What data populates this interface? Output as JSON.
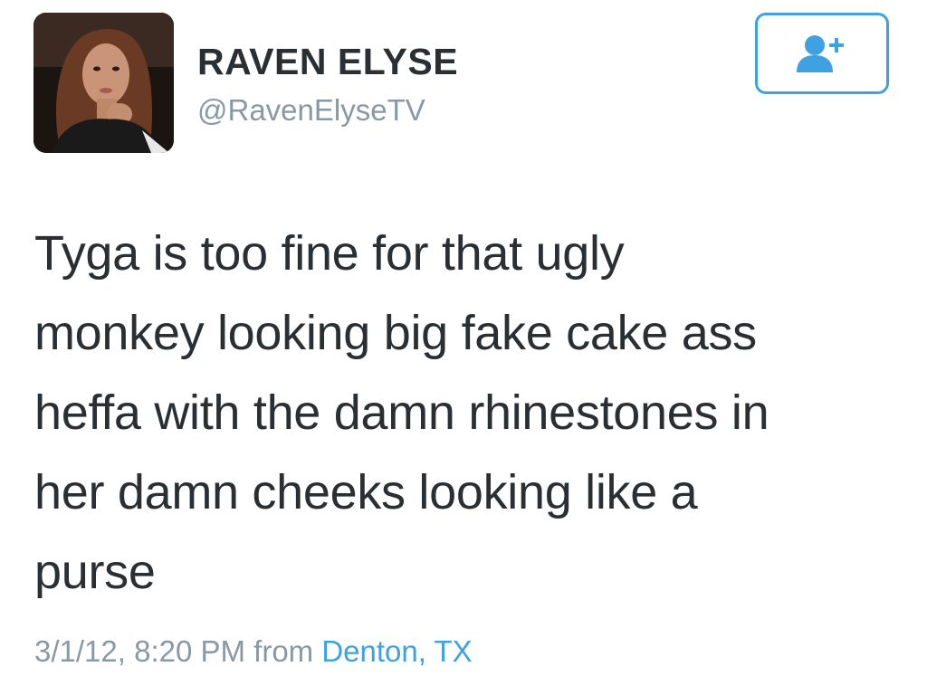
{
  "author": {
    "display_name": "RAVEN ELYSE",
    "handle": "@RavenElyseTV",
    "avatar": "profile-photo"
  },
  "follow_button": {
    "icon": "add-user-icon",
    "color": "#3ea1e2"
  },
  "tweet": {
    "text": "Tyga is too fine for that ugly\nmonkey looking big fake cake ass\nheffa with the damn rhinestones in\nher damn cheeks looking like a\npurse",
    "timestamp": "3/1/12, 8:20 PM",
    "from_label": "from",
    "location": "Denton, TX"
  },
  "colors": {
    "text": "#292f33",
    "secondary": "#8899a6",
    "accent": "#3ea1e2"
  }
}
